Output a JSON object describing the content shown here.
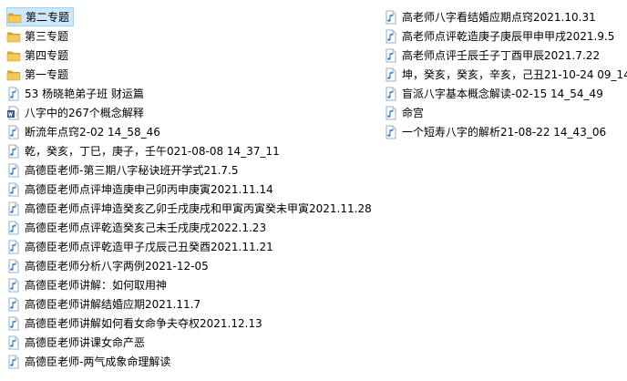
{
  "left_items": [
    {
      "label": "第二专题",
      "icon": "folder-icon",
      "selected": true
    },
    {
      "label": "第三专题",
      "icon": "folder-icon"
    },
    {
      "label": "第四专题",
      "icon": "folder-icon"
    },
    {
      "label": "第一专题",
      "icon": "folder-icon"
    },
    {
      "label": "53 杨晓艳弟子班 财运篇",
      "icon": "audio-file-icon"
    },
    {
      "label": "八字中的267个概念解释",
      "icon": "document-file-icon"
    },
    {
      "label": "断流年点窍2-02 14_58_46",
      "icon": "audio-file-icon"
    },
    {
      "label": "乾，癸亥，丁巳，庚子，壬午021-08-08 14_37_11",
      "icon": "audio-file-icon"
    },
    {
      "label": "高德臣老师-第三期八字秘诀班开学式21.7.5",
      "icon": "audio-file-icon"
    },
    {
      "label": "高德臣老师点评坤造庚申己卯丙申庚寅2021.11.14",
      "icon": "audio-file-icon"
    },
    {
      "label": "高德臣老师点评坤造癸亥乙卯壬戌庚戌和甲寅丙寅癸未甲寅2021.11.28",
      "icon": "audio-file-icon"
    },
    {
      "label": "高德臣老师点评乾造癸亥己未壬戌庚戌2022.1.23",
      "icon": "audio-file-icon"
    },
    {
      "label": "高德臣老师点评乾造甲子戊辰己丑癸酉2021.11.21",
      "icon": "audio-file-icon"
    },
    {
      "label": "高德臣老师分析八字两例2021-12-05",
      "icon": "audio-file-icon"
    },
    {
      "label": "高德臣老师讲解：如何取用神",
      "icon": "audio-file-icon"
    },
    {
      "label": "高德臣老师讲解结婚应期2021.11.7",
      "icon": "audio-file-icon"
    },
    {
      "label": "高德臣老师讲解如何看女命争夫夺权2021.12.13",
      "icon": "audio-file-icon"
    },
    {
      "label": "高德臣老师讲课女命产恶",
      "icon": "audio-file-icon"
    },
    {
      "label": "高德臣老师-两气成象命理解读",
      "icon": "audio-file-icon"
    }
  ],
  "right_items": [
    {
      "label": "高老师八字看结婚应期点窍2021.10.31",
      "icon": "audio-file-icon"
    },
    {
      "label": "高老师点评乾造庚子庚辰甲申甲戌2021.9.5",
      "icon": "audio-file-icon"
    },
    {
      "label": "高老师点评壬辰壬子丁酉甲辰2021.7.22",
      "icon": "audio-file-icon"
    },
    {
      "label": "坤，癸亥，癸亥，辛亥，己丑21-10-24 09_14_",
      "icon": "audio-file-icon"
    },
    {
      "label": "盲派八字基本概念解读-02-15 14_54_49",
      "icon": "audio-file-icon"
    },
    {
      "label": "命宫",
      "icon": "audio-file-icon"
    },
    {
      "label": "一个短寿八字的解析21-08-22 14_43_06",
      "icon": "audio-file-icon"
    }
  ],
  "colors": {
    "selection_bg": "#cce8ff",
    "selection_border": "#99d1ff",
    "folder": "#e8b94a",
    "audio_note": "#2f7fd1"
  }
}
